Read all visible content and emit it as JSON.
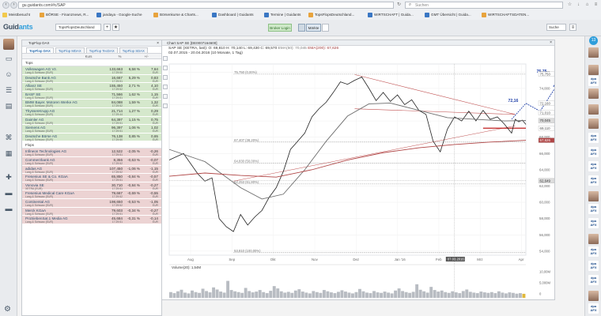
{
  "browser": {
    "url": "gu.guidants.com/#c/SAP",
    "search_placeholder": "Suchen",
    "bookmarks": [
      {
        "label": "Meistbesucht",
        "cls": "folder"
      },
      {
        "label": "BÖRSE - Finanznews, R...",
        "cls": ""
      },
      {
        "label": "jandaya - Google-Suche",
        "cls": "blue"
      },
      {
        "label": "Börsenkurse & Charts...",
        "cls": ""
      },
      {
        "label": "Dashboard | Guidants",
        "cls": "blue"
      },
      {
        "label": "Termine | Guidants",
        "cls": "blue"
      },
      {
        "label": "TopsFlopsDeutschland...",
        "cls": ""
      },
      {
        "label": "WIRTSCHAFT | Guida...",
        "cls": "blue"
      },
      {
        "label": "GMT Übersicht | Guida...",
        "cls": "blue"
      },
      {
        "label": "WIRTSCHAFTSDATEN...",
        "cls": ""
      }
    ]
  },
  "app": {
    "logo_main": "Guid",
    "logo_accent": "ants",
    "workspace": "TopsFlopsDeutschland",
    "broker_login": "Broker Login",
    "markets_label": "Märkte",
    "search_label": "Suche",
    "notification_count": "13"
  },
  "watchlist": {
    "title": "TopFlop DAX",
    "tabs": [
      "TopFlop DAX",
      "TopFlop MDAX",
      "TopFlop TecDAX",
      "TopFlop SDAX"
    ],
    "columns": [
      "Name",
      "Kurs",
      "%",
      "+/-"
    ],
    "tops_label": "Tops",
    "flops_label": "Flops",
    "tops": [
      {
        "name": "Volkswagen AG Vz.",
        "exch": "Lang & Schwarz (EUR)",
        "price": "133,663",
        "time": "17:29:50",
        "pct": "6,58 %",
        "abs": "7,64",
        "cur": "EUR"
      },
      {
        "name": "Deutsche Bank AG",
        "exch": "Lang & Schwarz (EUR)",
        "price": "16,667",
        "time": "17:29:51",
        "pct": "5,29 %",
        "abs": "0,83",
        "cur": "EUR"
      },
      {
        "name": "Allianz SE",
        "exch": "Lang & Schwarz (EUR)",
        "price": "155,450",
        "time": "17:29:52",
        "pct": "2,71 %",
        "abs": "4,10",
        "cur": "EUR"
      },
      {
        "name": "BASF SE",
        "exch": "Lang & Schwarz (EUR)",
        "price": "71,566",
        "time": "17:29:51",
        "pct": "1,62 %",
        "abs": "1,15",
        "cur": "EUR"
      },
      {
        "name": "BMW Bayer. Motoren Werke AG",
        "exch": "Lang & Schwarz (EUR)",
        "price": "84,088",
        "time": "17:29:52",
        "pct": "1,59 %",
        "abs": "1,32",
        "cur": "EUR"
      },
      {
        "name": "ThyssenKrupp AG",
        "exch": "Lang & Schwarz (EUR)",
        "price": "21,714",
        "time": "17:29:44",
        "pct": "1,27 %",
        "abs": "0,29",
        "cur": "EUR"
      },
      {
        "name": "Daimler AG",
        "exch": "Lang & Schwarz (EUR)",
        "price": "64,397",
        "time": "17:29:51",
        "pct": "1,15 %",
        "abs": "0,75",
        "cur": "EUR"
      },
      {
        "name": "Siemens AG",
        "exch": "Lang & Schwarz (EUR)",
        "price": "96,397",
        "time": "17:29:51",
        "pct": "1,06 %",
        "abs": "1,02",
        "cur": "EUR"
      },
      {
        "name": "Deutsche Börse AG",
        "exch": "Lang & Schwarz (EUR)",
        "price": "76,138",
        "time": "17:29:50",
        "pct": "0,85 %",
        "abs": "0,65",
        "cur": "EUR"
      }
    ],
    "flops": [
      {
        "name": "Infineon Technologies AG",
        "exch": "Lang & Schwarz (EUR)",
        "price": "12,522",
        "time": "17:29:51",
        "pct": "-2,05 %",
        "abs": "-0,26",
        "cur": "EUR"
      },
      {
        "name": "Commerzbank AG",
        "exch": "Lang & Schwarz (EUR)",
        "price": "8,356",
        "time": "17:29:52",
        "pct": "-0,63 %",
        "abs": "-0,07",
        "cur": "EUR"
      },
      {
        "name": "adidas AG",
        "exch": "Lang & Schwarz (EUR)",
        "price": "107,450",
        "time": "17:29:52",
        "pct": "-1,06 %",
        "abs": "-1,15",
        "cur": "EUR"
      },
      {
        "name": "Fresenius SE & Co. KGaA",
        "exch": "Lang & Schwarz (EUR)",
        "price": "65,850",
        "time": "17:29:51",
        "pct": "-0,84 %",
        "abs": "-0,57",
        "cur": "EUR"
      },
      {
        "name": "Vonovia SE",
        "exch": "XETRA (EUR)",
        "price": "30,710",
        "time": "17:29:51",
        "pct": "-0,84 %",
        "abs": "-0,27",
        "cur": "EUR"
      },
      {
        "name": "Fresenius Medical Care KGaA",
        "exch": "Lang & Schwarz (EUR)",
        "price": "79,667",
        "time": "17:29:52",
        "pct": "-0,69 %",
        "abs": "-0,55",
        "cur": "EUR"
      },
      {
        "name": "Continental AG",
        "exch": "Lang & Schwarz (EUR)",
        "price": "198,650",
        "time": "17:29:52",
        "pct": "-0,53 %",
        "abs": "-1,05",
        "cur": "EUR"
      },
      {
        "name": "Merck KGaA",
        "exch": "Lang & Schwarz (EUR)",
        "price": "79,603",
        "time": "17:29:51",
        "pct": "-0,34 %",
        "abs": "-0,27",
        "cur": "EUR"
      },
      {
        "name": "ProSiebenSat.1 Media AG",
        "exch": "Lang & Schwarz (EUR)",
        "price": "45,684",
        "time": "17:29:51",
        "pct": "-0,31 %",
        "abs": "-0,14",
        "cur": "EUR"
      }
    ]
  },
  "chart_panel": {
    "title": "Chart SAP SE [DE0007164600]",
    "header_line1": "SAP SE (XETRA, last): O: 69,810  H: 70,140  L: 69,430  C: 69,570",
    "ema50_label": "EMA(50): 70,045",
    "ema200_label": "EMA(200): 67,626",
    "header_line2": "02.07.2015 - 20.04.2016 (10 Monate, 1 Tag)",
    "volume_label": "Volume(20): 1,54M"
  },
  "chart_data": {
    "type": "line",
    "title": "SAP SE (XETRA, last)",
    "x_range": [
      "2015-07-02",
      "2016-04-20"
    ],
    "x_ticks": [
      "Aug",
      "Sep",
      "Okt",
      "Nov",
      "Dez",
      "Jan '16",
      "Feb",
      "Mrz",
      "Apr"
    ],
    "y_ticks": [
      54.0,
      56.0,
      58.0,
      60.0,
      62.0,
      64.0,
      66.0,
      68.0,
      70.0,
      72.0,
      74.0,
      76.0
    ],
    "ylim": [
      53.5,
      77.0
    ],
    "series": [
      {
        "name": "SAP SE",
        "color": "#222222",
        "points": [
          [
            0,
            65.2
          ],
          [
            4,
            66.0
          ],
          [
            8,
            63.5
          ],
          [
            10,
            62.6
          ],
          [
            12,
            63.0
          ],
          [
            14,
            58.0
          ],
          [
            16,
            57.0
          ],
          [
            18,
            56.4
          ],
          [
            20,
            58.5
          ],
          [
            22,
            57.2
          ],
          [
            24,
            58.2
          ],
          [
            26,
            59.0
          ],
          [
            28,
            60.6
          ],
          [
            30,
            61.8
          ],
          [
            32,
            63.8
          ],
          [
            34,
            66.5
          ],
          [
            36,
            67.5
          ],
          [
            38,
            68.5
          ],
          [
            40,
            70.5
          ],
          [
            42,
            71.5
          ],
          [
            44,
            72.3
          ],
          [
            46,
            73.5
          ],
          [
            48,
            74.8
          ],
          [
            50,
            74.5
          ],
          [
            52,
            75.0
          ],
          [
            54,
            75.4
          ],
          [
            56,
            74.0
          ],
          [
            58,
            72.5
          ],
          [
            60,
            73.5
          ],
          [
            62,
            72.4
          ],
          [
            64,
            73.2
          ],
          [
            66,
            72.0
          ],
          [
            68,
            72.6
          ],
          [
            70,
            71.3
          ],
          [
            72,
            70.8
          ],
          [
            74,
            67.5
          ],
          [
            76,
            66.2
          ],
          [
            78,
            69.0
          ],
          [
            80,
            70.5
          ],
          [
            82,
            70.0
          ],
          [
            84,
            71.2
          ],
          [
            86,
            70.0
          ],
          [
            88,
            71.3
          ],
          [
            90,
            70.2
          ],
          [
            92,
            70.5
          ],
          [
            94,
            69.6
          ],
          [
            96,
            68.5
          ],
          [
            97,
            70.2
          ],
          [
            98,
            69.9
          ],
          [
            99,
            70.1
          ],
          [
            100,
            69.57
          ]
        ]
      },
      {
        "name": "EMA(50)",
        "color": "#6e6e6e",
        "points": [
          [
            0,
            66.5
          ],
          [
            10,
            65.0
          ],
          [
            20,
            61.8
          ],
          [
            26,
            60.4
          ],
          [
            32,
            61.0
          ],
          [
            38,
            64.0
          ],
          [
            44,
            67.5
          ],
          [
            50,
            70.6
          ],
          [
            56,
            72.1
          ],
          [
            62,
            72.2
          ],
          [
            70,
            71.3
          ],
          [
            78,
            70.4
          ],
          [
            86,
            70.2
          ],
          [
            94,
            70.0
          ],
          [
            100,
            70.045
          ]
        ]
      },
      {
        "name": "EMA(200)",
        "color": "#b04545",
        "points": [
          [
            0,
            63.2
          ],
          [
            10,
            63.6
          ],
          [
            20,
            63.3
          ],
          [
            30,
            63.1
          ],
          [
            40,
            64.0
          ],
          [
            50,
            65.2
          ],
          [
            60,
            66.1
          ],
          [
            70,
            66.7
          ],
          [
            80,
            67.1
          ],
          [
            90,
            67.4
          ],
          [
            100,
            67.626
          ]
        ]
      }
    ],
    "fibonacci_levels": [
      {
        "label": "75,750 (0,00%)",
        "value": 75.75
      },
      {
        "label": "67,407 (38,20%)",
        "value": 67.407
      },
      {
        "label": "64,830 (50,00%)",
        "value": 64.83
      },
      {
        "label": "62,253 (61,80%)",
        "value": 62.253
      },
      {
        "label": "53,810 (100,00%)",
        "value": 53.81
      }
    ],
    "annotations": [
      {
        "label": "75,75",
        "value": 75.75,
        "color": "#1f3fa8"
      },
      {
        "label": "72,16",
        "value": 72.16,
        "color": "#1f3fa8"
      }
    ],
    "price_markers": [
      {
        "label": "75,750",
        "value": 75.75,
        "bg": "#ffffff",
        "fg": "#555555"
      },
      {
        "label": "72,160",
        "value": 72.16,
        "bg": "#ffffff",
        "fg": "#555555"
      },
      {
        "label": "71,010",
        "value": 71.01,
        "bg": "#ffffff",
        "fg": "#555555"
      },
      {
        "label": "70,045",
        "value": 70.045,
        "bg": "#dddddd",
        "fg": "#333333"
      },
      {
        "label": "69,110",
        "value": 69.11,
        "bg": "#ffffff",
        "fg": "#555555"
      },
      {
        "label": "67,626",
        "value": 67.626,
        "bg": "#b04545",
        "fg": "#ffffff"
      },
      {
        "label": "62,649",
        "value": 62.649,
        "bg": "#dddddd",
        "fg": "#333333"
      }
    ],
    "crosshair": {
      "date_label": "07.03.2016",
      "x_pct": 80
    },
    "volume": {
      "label": "Volume(20): 1,54M",
      "y_ticks": [
        "10,00M",
        "5,000M",
        "0"
      ],
      "values": [
        2.2,
        1.8,
        2.5,
        3.1,
        2.0,
        1.7,
        2.8,
        2.2,
        1.9,
        3.5,
        2.6,
        2.1,
        4.0,
        3.2,
        2.4,
        2.0,
        6.5,
        3.0,
        2.5,
        2.2,
        1.9,
        3.8,
        2.6,
        2.1,
        2.4,
        3.0,
        2.2,
        1.8,
        2.7,
        4.5,
        3.6,
        2.5,
        2.0,
        2.3,
        1.9,
        2.8,
        3.3,
        2.4,
        2.0,
        1.7,
        2.6,
        2.2,
        1.9,
        3.0,
        2.5,
        2.1,
        1.8,
        2.3,
        2.9,
        2.4,
        2.0,
        1.7,
        2.2,
        3.4,
        2.5,
        2.0,
        1.8,
        2.6,
        2.1,
        1.9,
        2.4,
        2.0,
        1.7,
        2.8,
        3.6,
        2.6,
        2.2,
        1.9,
        2.3,
        5.2,
        3.1,
        2.5,
        2.0,
        4.2,
        3.0,
        2.4,
        2.8,
        2.2,
        1.9,
        2.5,
        2.1,
        1.8,
        2.6,
        3.2,
        2.3,
        2.0,
        1.8,
        2.4,
        2.1,
        1.9,
        2.2,
        1.8,
        2.5,
        2.0,
        1.7,
        2.1,
        1.9,
        1.6,
        1.8,
        1.54
      ]
    }
  }
}
